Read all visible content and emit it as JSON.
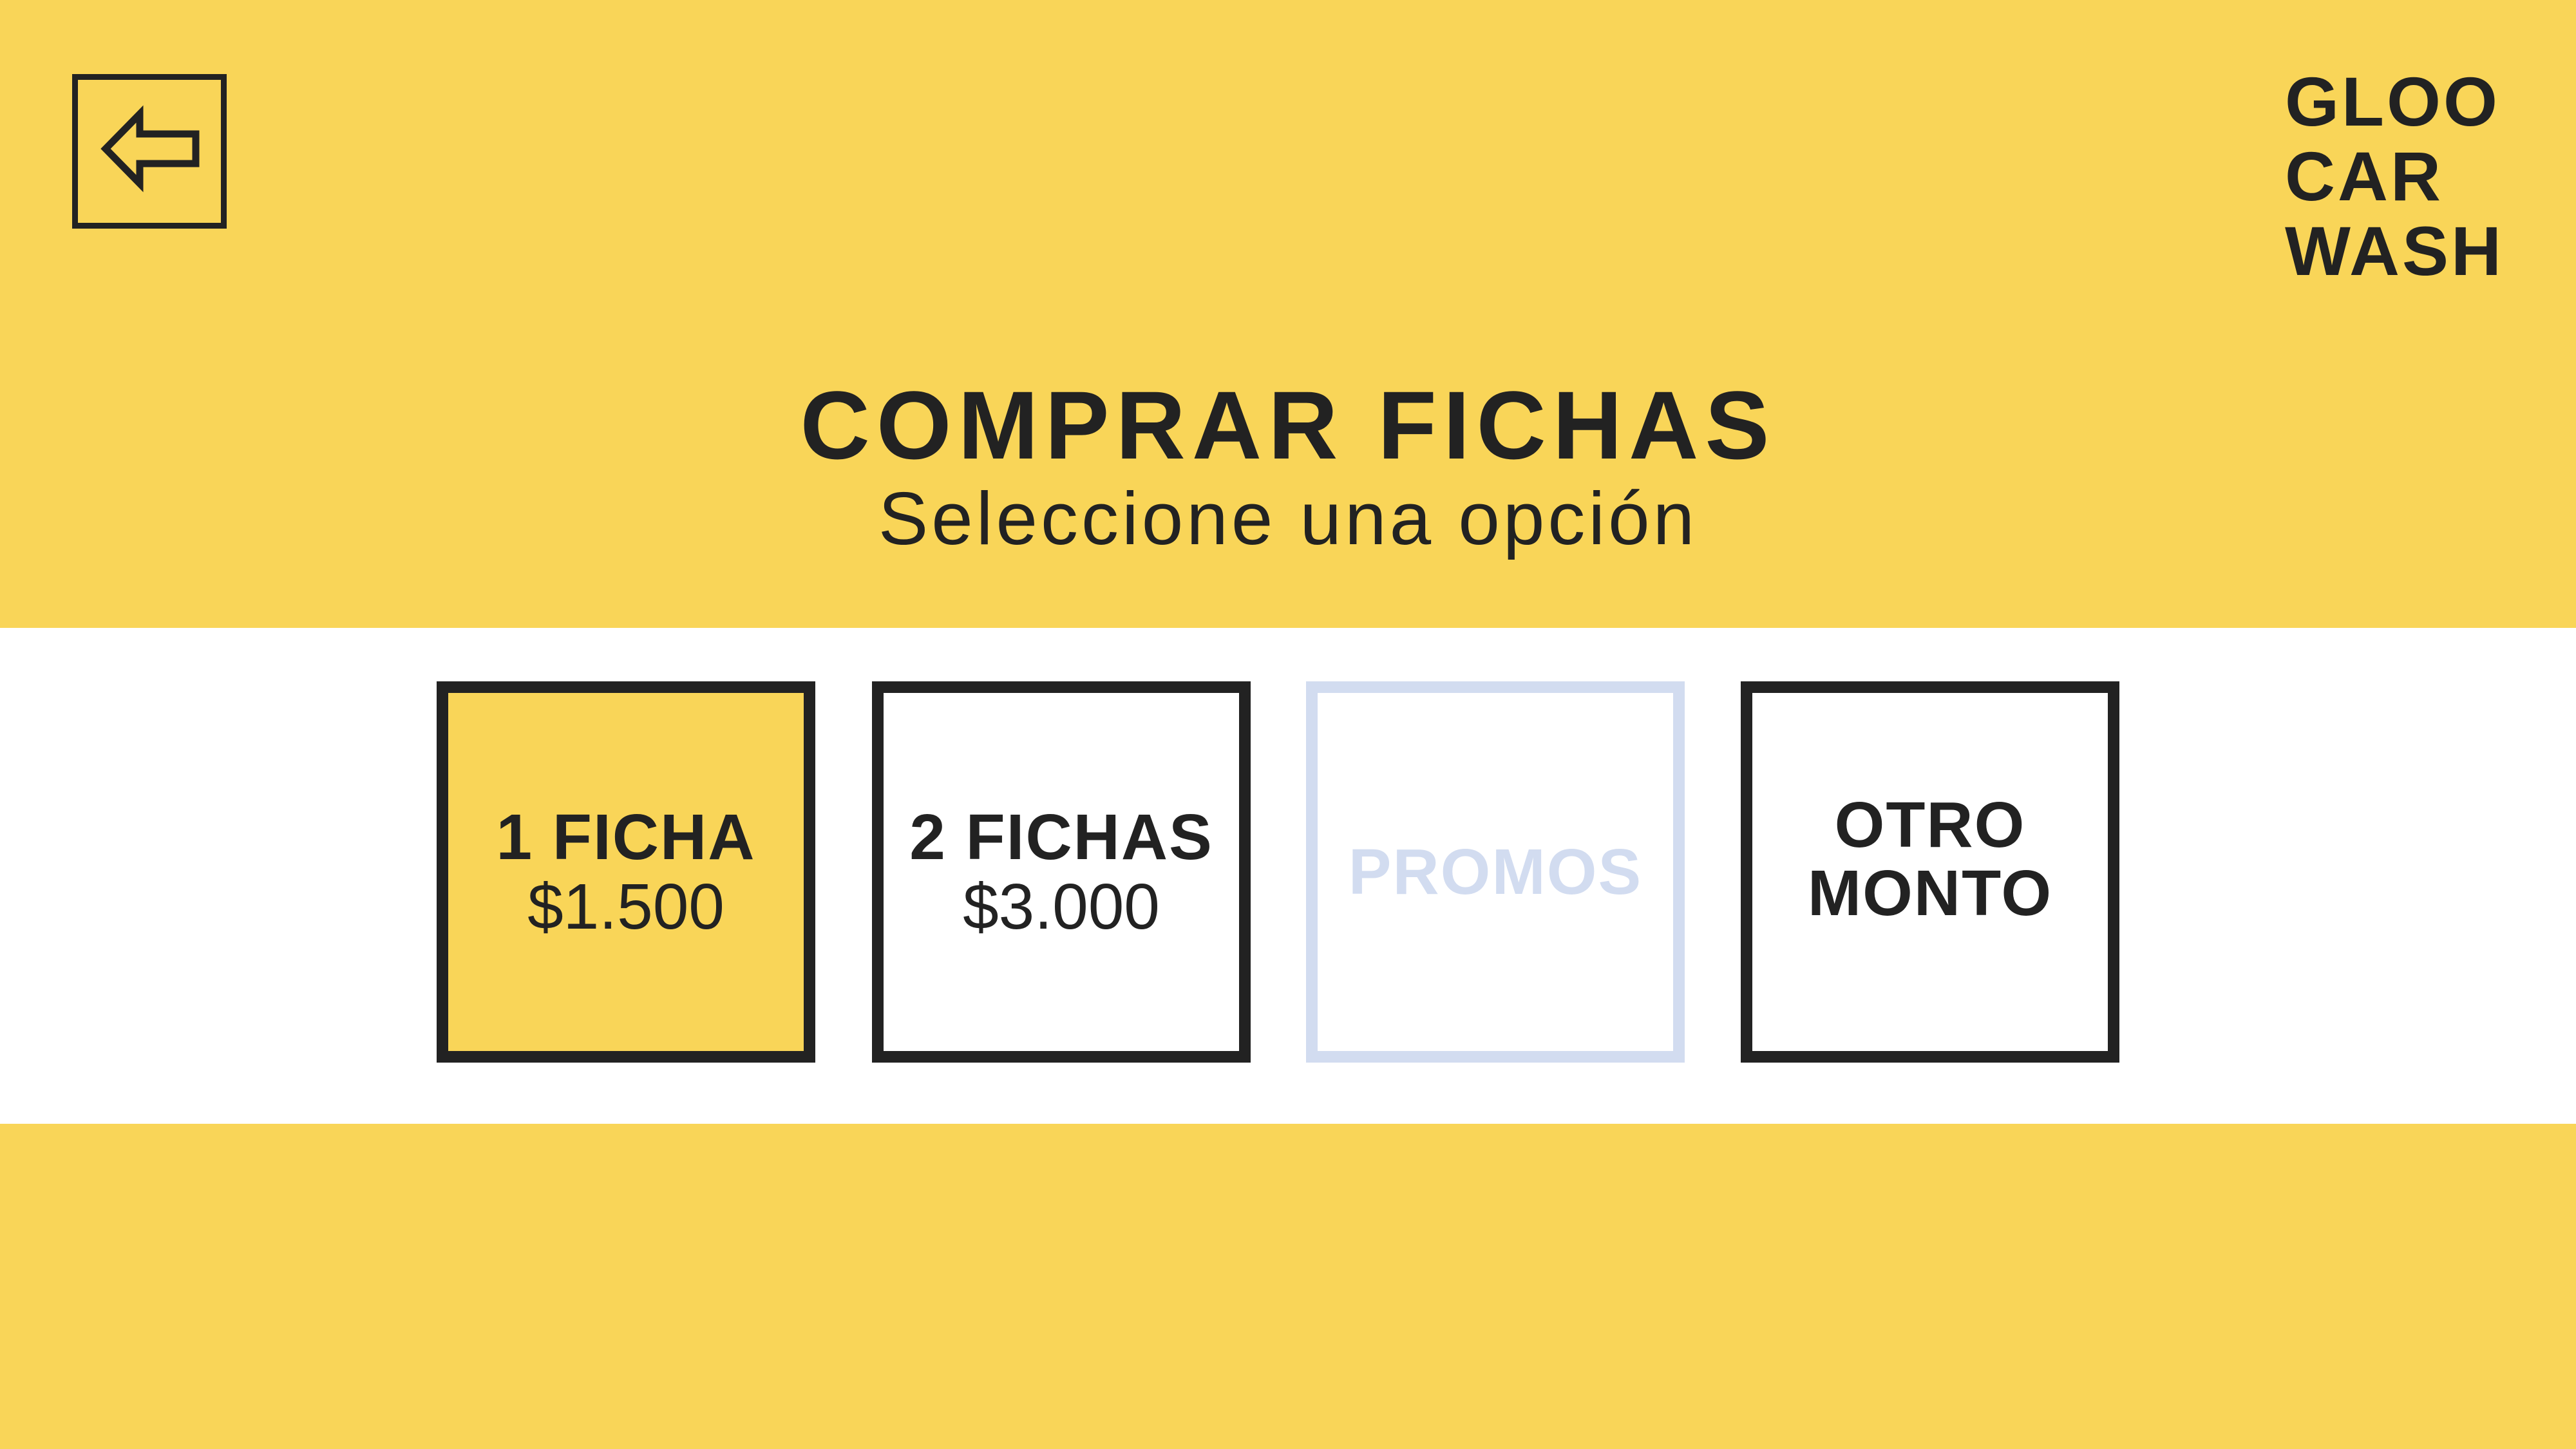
{
  "app": {
    "logo_lines": [
      "GLOO",
      "CAR",
      "WASH"
    ]
  },
  "header": {
    "back_icon": "arrow-left-icon",
    "title": "COMPRAR FICHAS",
    "subtitle": "Seleccione una opción"
  },
  "options": [
    {
      "label": "1 FICHA",
      "price": "$1.500",
      "state": "selected"
    },
    {
      "label": "2 FICHAS",
      "price": "$3.000",
      "state": "default"
    },
    {
      "label": "PROMOS",
      "price": "",
      "state": "disabled"
    },
    {
      "label": "OTRO MONTO",
      "price": "",
      "state": "default"
    }
  ],
  "colors": {
    "background_yellow": "#F9D558",
    "panel_white": "#FFFFFF",
    "text_dark": "#222222",
    "disabled": "#D2DCF0"
  }
}
